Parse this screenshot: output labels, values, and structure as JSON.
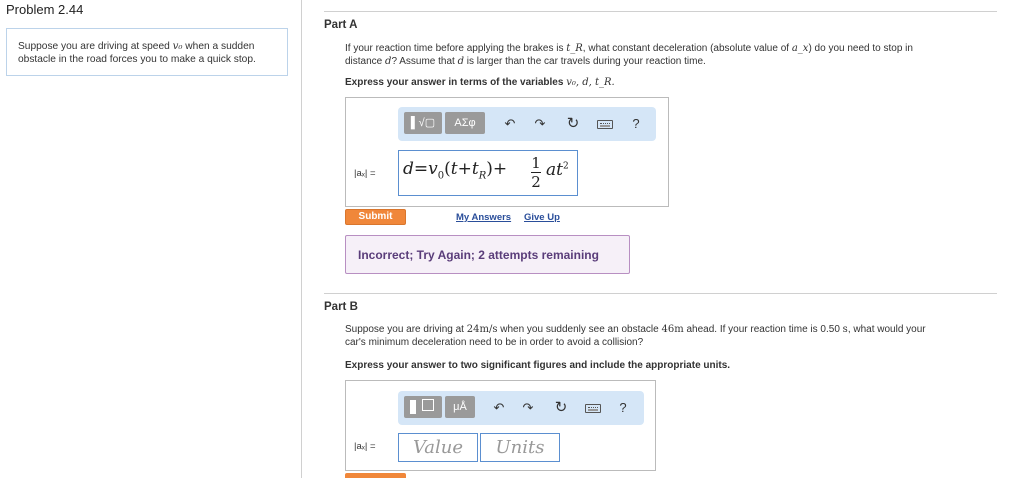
{
  "problem": {
    "title": "Problem 2.44"
  },
  "intro": {
    "line1_pre": "Suppose you are driving at speed ",
    "line1_var": "v₀",
    "line1_post": " when a sudden",
    "line2": "obstacle in the road forces you to make a quick stop."
  },
  "part_a": {
    "label": "Part A",
    "q_l1_a": "If your reaction time before applying the brakes is ",
    "q_l1_var1": "t_R",
    "q_l1_b": ", what constant deceleration (absolute value of ",
    "q_l1_var2": "a_x",
    "q_l1_c": ") do you need to stop in",
    "q_l2_a": "distance ",
    "q_l2_var": "d",
    "q_l2_b": "? Assume that ",
    "q_l2_var2": "d",
    "q_l2_c": " is larger than the car travels during your reaction time.",
    "instruction": "Express your answer in terms of the variables ",
    "instruction_vars": "v₀, d, t_R.",
    "answer_label": "|aₓ| =",
    "toolbar": {
      "templates_label": "▌√▢",
      "symbols_label": "ΑΣφ",
      "help_label": "?"
    },
    "formula": {
      "lhs": "d",
      "eq": "=",
      "v": "v",
      "v_sub": "0",
      "open": "(",
      "t": "t",
      "plus1": "+",
      "tr": "t",
      "tr_sub": "R",
      "close": ")",
      "plus2": "+",
      "frac_num": "1",
      "frac_den": "2",
      "at": "at",
      "sq": "2"
    },
    "submit_label": "Submit",
    "my_answers_label": "My Answers",
    "give_up_label": "Give Up",
    "feedback": "Incorrect; Try Again; 2 attempts remaining"
  },
  "part_b": {
    "label": "Part B",
    "q_l1_a": "Suppose you are driving at ",
    "q_l1_speed": "24m/s",
    "q_l1_b": " when you suddenly see an obstacle ",
    "q_l1_dist": "46m",
    "q_l1_c": " ahead. If your reaction time is 0.50 ",
    "q_l1_s": "s",
    "q_l1_d": ", what would your",
    "q_l2": "car's minimum deceleration need to be in order to avoid a collision?",
    "instruction": "Express your answer to two significant figures and include the appropriate units.",
    "answer_label": "|aₓ| =",
    "toolbar": {
      "units_label": "μÅ",
      "help_label": "?"
    },
    "value_placeholder": "Value",
    "units_placeholder": "Units"
  },
  "colors": {
    "accent_orange": "#f0873a",
    "toolbar_blue": "#d5e6f7",
    "feedback_purple": "#5a3d7a",
    "link_blue": "#2a4e9a"
  },
  "icons": [
    "undo-icon",
    "redo-icon",
    "reset-icon",
    "keyboard-icon",
    "help-icon"
  ]
}
